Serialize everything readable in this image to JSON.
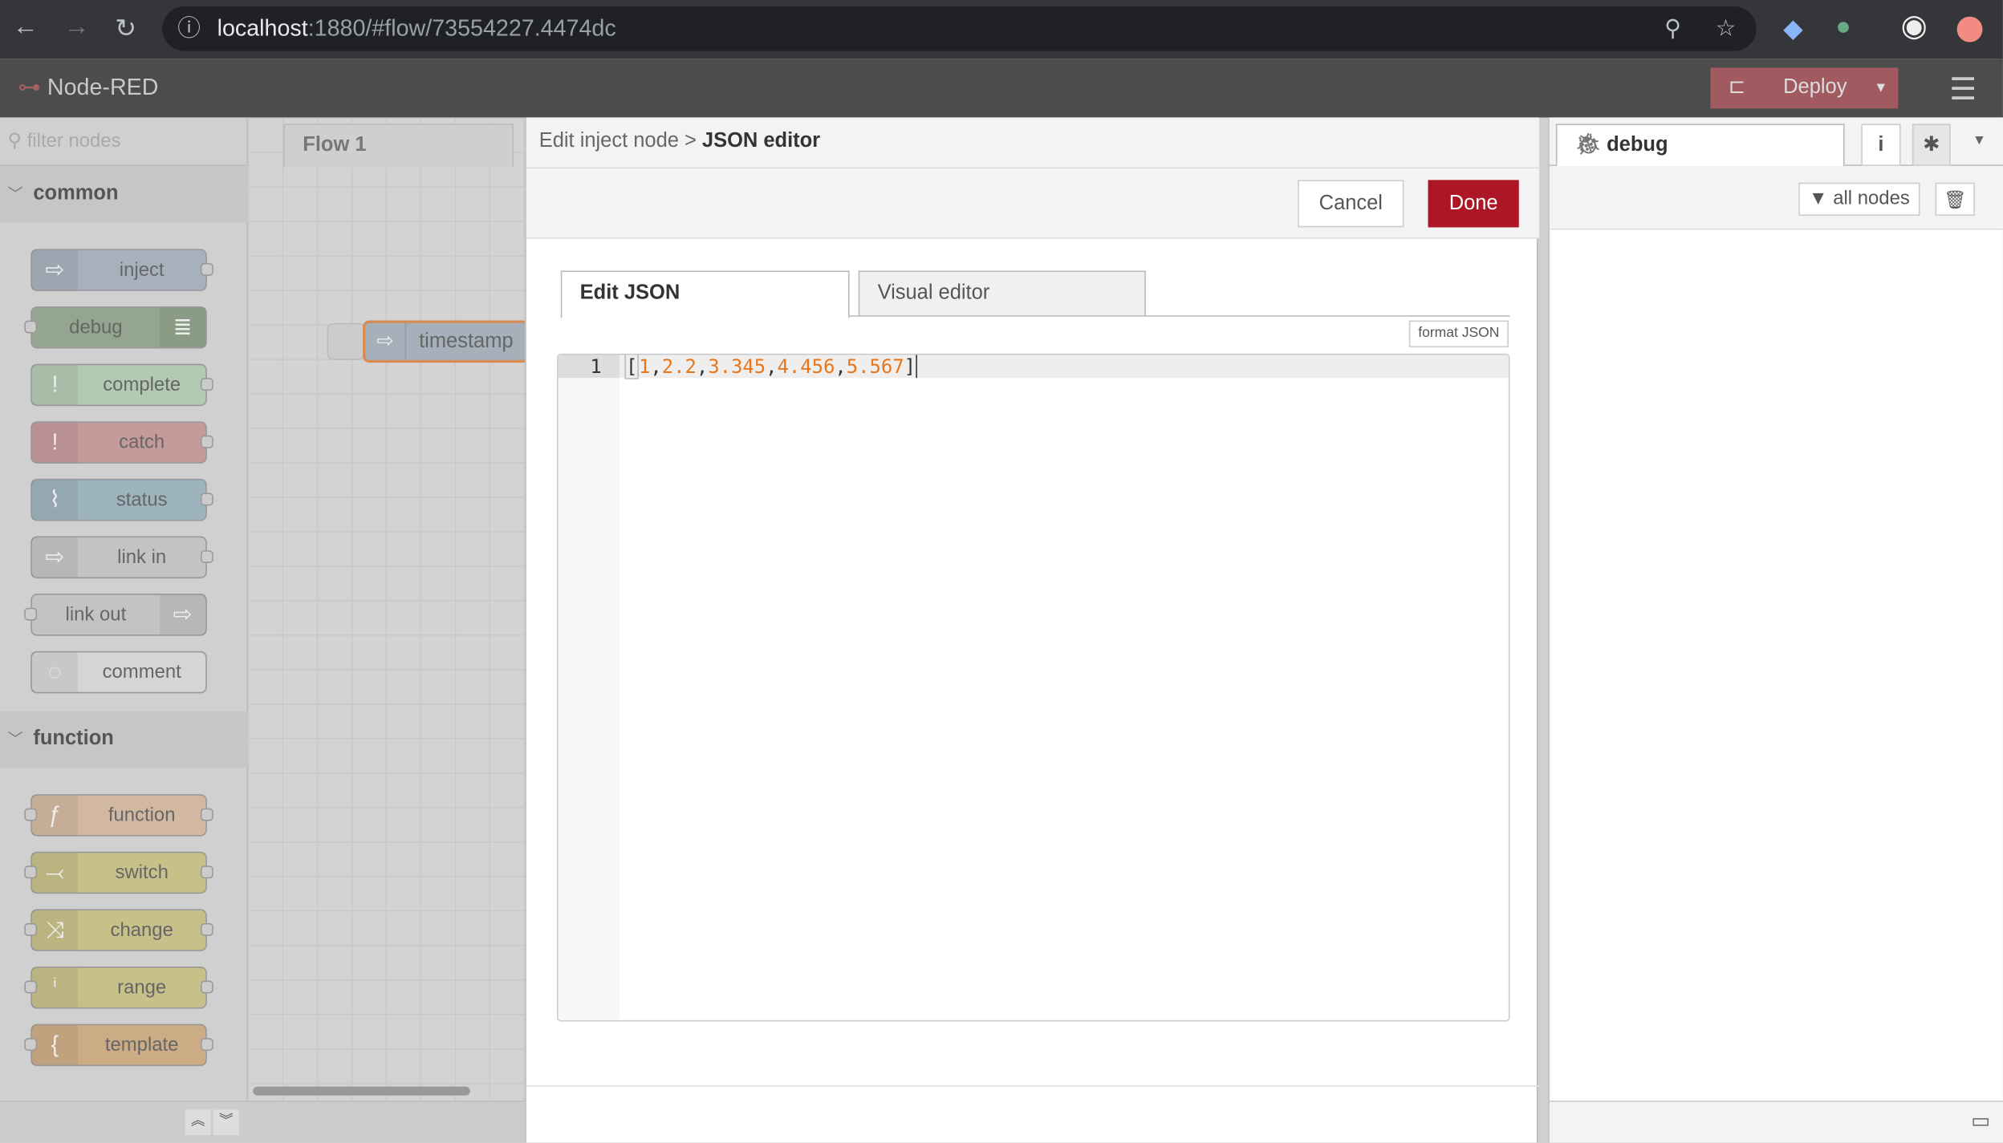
{
  "browser": {
    "url_host": "localhost",
    "url_rest": ":1880/#flow/73554227.4474dc"
  },
  "app": {
    "title": "Node-RED",
    "deploy_label": "Deploy",
    "accent": "#ad1625"
  },
  "palette": {
    "filter_placeholder": "filter nodes",
    "categories": [
      {
        "label": "common",
        "nodes": [
          {
            "label": "inject",
            "icon": "arrow-right-icon",
            "color": "#a6b1bd"
          },
          {
            "label": "debug",
            "icon": "list-icon",
            "color": "#94a68f"
          },
          {
            "label": "complete",
            "icon": "exclamation-icon",
            "color": "#b2c9b2"
          },
          {
            "label": "catch",
            "icon": "exclamation-icon",
            "color": "#c59a9b"
          },
          {
            "label": "status",
            "icon": "pulse-icon",
            "color": "#9db3be"
          },
          {
            "label": "link in",
            "icon": "link-in-icon",
            "color": "#c3c3c3"
          },
          {
            "label": "link out",
            "icon": "link-out-icon",
            "color": "#c3c3c3"
          },
          {
            "label": "comment",
            "icon": "speech-bubble-icon",
            "color": "#d5d5d5"
          }
        ]
      },
      {
        "label": "function",
        "nodes": [
          {
            "label": "function",
            "icon": "function-icon",
            "color": "#d2b8a0"
          },
          {
            "label": "switch",
            "icon": "switch-icon",
            "color": "#c7c089"
          },
          {
            "label": "change",
            "icon": "shuffle-icon",
            "color": "#c7c089"
          },
          {
            "label": "range",
            "icon": "range-icon",
            "color": "#c7c089"
          },
          {
            "label": "template",
            "icon": "brace-icon",
            "color": "#ccac85"
          }
        ]
      }
    ]
  },
  "workspace": {
    "tab": "Flow 1",
    "node_label": "timestamp"
  },
  "dialog": {
    "breadcrumb": "Edit inject node > ",
    "title": "JSON editor",
    "cancel": "Cancel",
    "done": "Done",
    "tabs": [
      {
        "label": "Edit JSON",
        "active": true
      },
      {
        "label": "Visual editor",
        "active": false
      }
    ],
    "format_button": "format JSON",
    "line_number": "1",
    "code": {
      "open": "[",
      "values": [
        "1",
        "2.2",
        "3.345",
        "4.456",
        "5.567"
      ],
      "close": "]"
    }
  },
  "sidebar": {
    "tab": "debug",
    "filter": "all nodes"
  }
}
